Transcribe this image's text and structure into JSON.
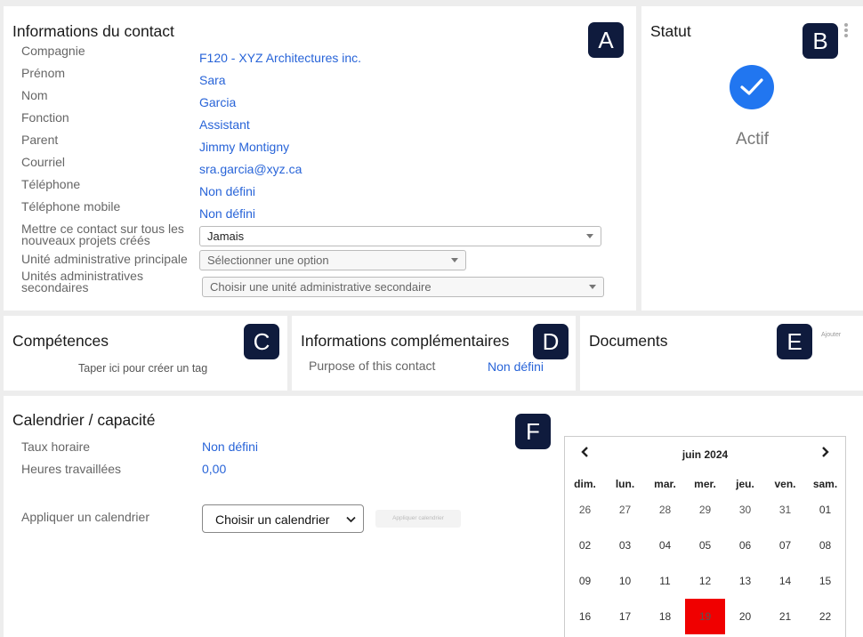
{
  "contact": {
    "title": "Informations du contact",
    "badge": "A",
    "fields": [
      {
        "label": "Compagnie",
        "value": "F120 - XYZ Architectures inc."
      },
      {
        "label": "Prénom",
        "value": "Sara"
      },
      {
        "label": "Nom",
        "value": "Garcia"
      },
      {
        "label": "Fonction",
        "value": "Assistant"
      },
      {
        "label": "Parent",
        "value": "Jimmy Montigny"
      },
      {
        "label": "Courriel",
        "value": "sra.garcia@xyz.ca"
      },
      {
        "label": "Téléphone",
        "value": "Non défini"
      },
      {
        "label": "Téléphone mobile",
        "value": "Non défini"
      }
    ],
    "all_projects_label_1": "Mettre ce contact sur tous les",
    "all_projects_label_2": "nouveaux projets créés",
    "all_projects_value": "Jamais",
    "main_unit_label": "Unité administrative principale",
    "main_unit_placeholder": "Sélectionner une option",
    "secondary_units_label_1": "Unités administratives",
    "secondary_units_label_2": "secondaires",
    "secondary_units_placeholder": "Choisir une unité administrative secondaire"
  },
  "status": {
    "title": "Statut",
    "badge": "B",
    "value": "Actif",
    "accent": "#2176f0"
  },
  "skills": {
    "title": "Compétences",
    "badge": "C",
    "hint": "Taper ici pour créer un tag"
  },
  "extra": {
    "title": "Informations complémentaires",
    "badge": "D",
    "field_label": "Purpose of this contact",
    "field_value": "Non défini"
  },
  "documents": {
    "title": "Documents",
    "badge": "E",
    "add_label": "Ajouter"
  },
  "calendar_panel": {
    "title": "Calendrier / capacité",
    "badge": "F",
    "rate_label": "Taux horaire",
    "rate_value": "Non défini",
    "hours_label": "Heures travaillées",
    "hours_value": "0,00",
    "apply_label": "Appliquer un calendrier",
    "apply_select": "Choisir un calendrier",
    "apply_button": "Appliquer calendrier"
  },
  "calendar": {
    "month": "juin 2024",
    "prev_icon": "chevron-left-icon",
    "next_icon": "chevron-right-icon",
    "weekdays": [
      "dim.",
      "lun.",
      "mar.",
      "mer.",
      "jeu.",
      "ven.",
      "sam."
    ],
    "weeks": [
      [
        "26",
        "27",
        "28",
        "29",
        "30",
        "31",
        "01"
      ],
      [
        "02",
        "03",
        "04",
        "05",
        "06",
        "07",
        "08"
      ],
      [
        "09",
        "10",
        "11",
        "12",
        "13",
        "14",
        "15"
      ],
      [
        "16",
        "17",
        "18",
        "19",
        "20",
        "21",
        "22"
      ]
    ],
    "today": "19",
    "today_color": "#f00000"
  }
}
